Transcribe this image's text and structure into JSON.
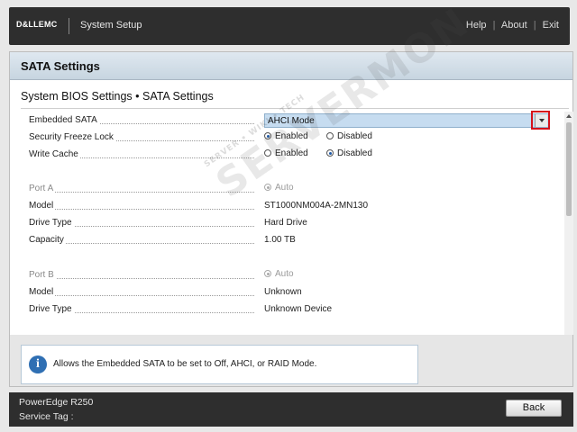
{
  "topbar": {
    "logo": "D&LLEMC",
    "title": "System Setup",
    "links": [
      "Help",
      "About",
      "Exit"
    ],
    "separator": "|"
  },
  "page": {
    "title": "SATA Settings",
    "breadcrumb": "System BIOS Settings • SATA Settings"
  },
  "settings": {
    "embedded_sata": {
      "label": "Embedded SATA",
      "value": "AHCI Mode"
    },
    "security_freeze_lock": {
      "label": "Security Freeze Lock",
      "options": [
        "Enabled",
        "Disabled"
      ],
      "selected": "Enabled"
    },
    "write_cache": {
      "label": "Write Cache",
      "options": [
        "Enabled",
        "Disabled"
      ],
      "selected": "Disabled"
    },
    "port_a": {
      "label": "Port A",
      "value": "Auto"
    },
    "port_a_model": {
      "label": "Model",
      "value": "ST1000NM004A-2MN130"
    },
    "port_a_drive_type": {
      "label": "Drive Type",
      "value": "Hard Drive"
    },
    "port_a_capacity": {
      "label": "Capacity",
      "value": "1.00 TB"
    },
    "port_b": {
      "label": "Port B",
      "value": "Auto"
    },
    "port_b_model": {
      "label": "Model",
      "value": "Unknown"
    },
    "port_b_drive_type": {
      "label": "Drive Type",
      "value": "Unknown Device"
    }
  },
  "help": {
    "icon": "i",
    "text": "Allows the Embedded SATA to be set to Off, AHCI, or RAID Mode."
  },
  "footer": {
    "model": "PowerEdge R250",
    "service_tag": "Service Tag :",
    "back_label": "Back"
  },
  "watermark": {
    "main": "SERVERMON",
    "sub": "SERVER • WIKI • TECH"
  },
  "colors": {
    "topbar": "#2e2e2e",
    "header": "#c7d5e0",
    "select": "#c6dcf0",
    "highlight": "#d6121b",
    "info": "#2f6fb3"
  }
}
